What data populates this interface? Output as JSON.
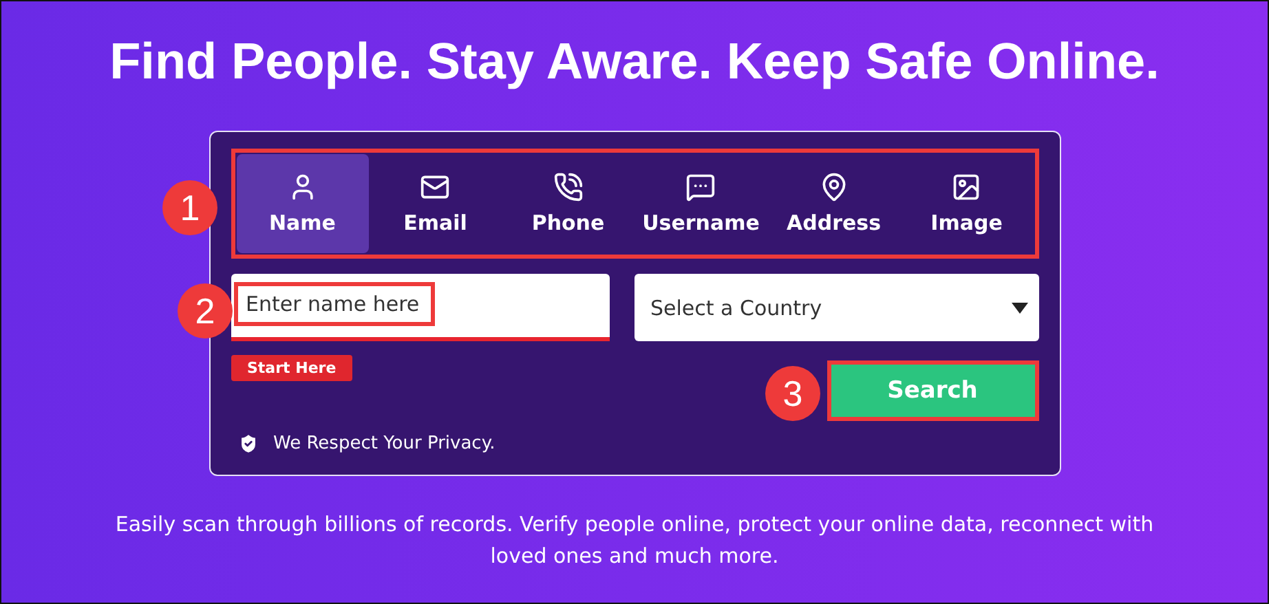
{
  "headline": "Find People. Stay Aware. Keep Safe Online.",
  "tabs": [
    {
      "label": "Name",
      "kind": "person",
      "selected": true
    },
    {
      "label": "Email",
      "kind": "mail",
      "selected": false
    },
    {
      "label": "Phone",
      "kind": "phone",
      "selected": false
    },
    {
      "label": "Username",
      "kind": "chat",
      "selected": false
    },
    {
      "label": "Address",
      "kind": "pin",
      "selected": false
    },
    {
      "label": "Image",
      "kind": "image",
      "selected": false
    }
  ],
  "name_field": {
    "placeholder": "Enter name here"
  },
  "country_select": {
    "value": "Select a Country"
  },
  "start_badge": "Start Here",
  "search_button": "Search",
  "privacy_note": "We Respect Your Privacy.",
  "description": "Easily scan through billions of records. Verify people online, protect your online data, reconnect with loved ones and much more.",
  "annotations": [
    "1",
    "2",
    "3"
  ]
}
